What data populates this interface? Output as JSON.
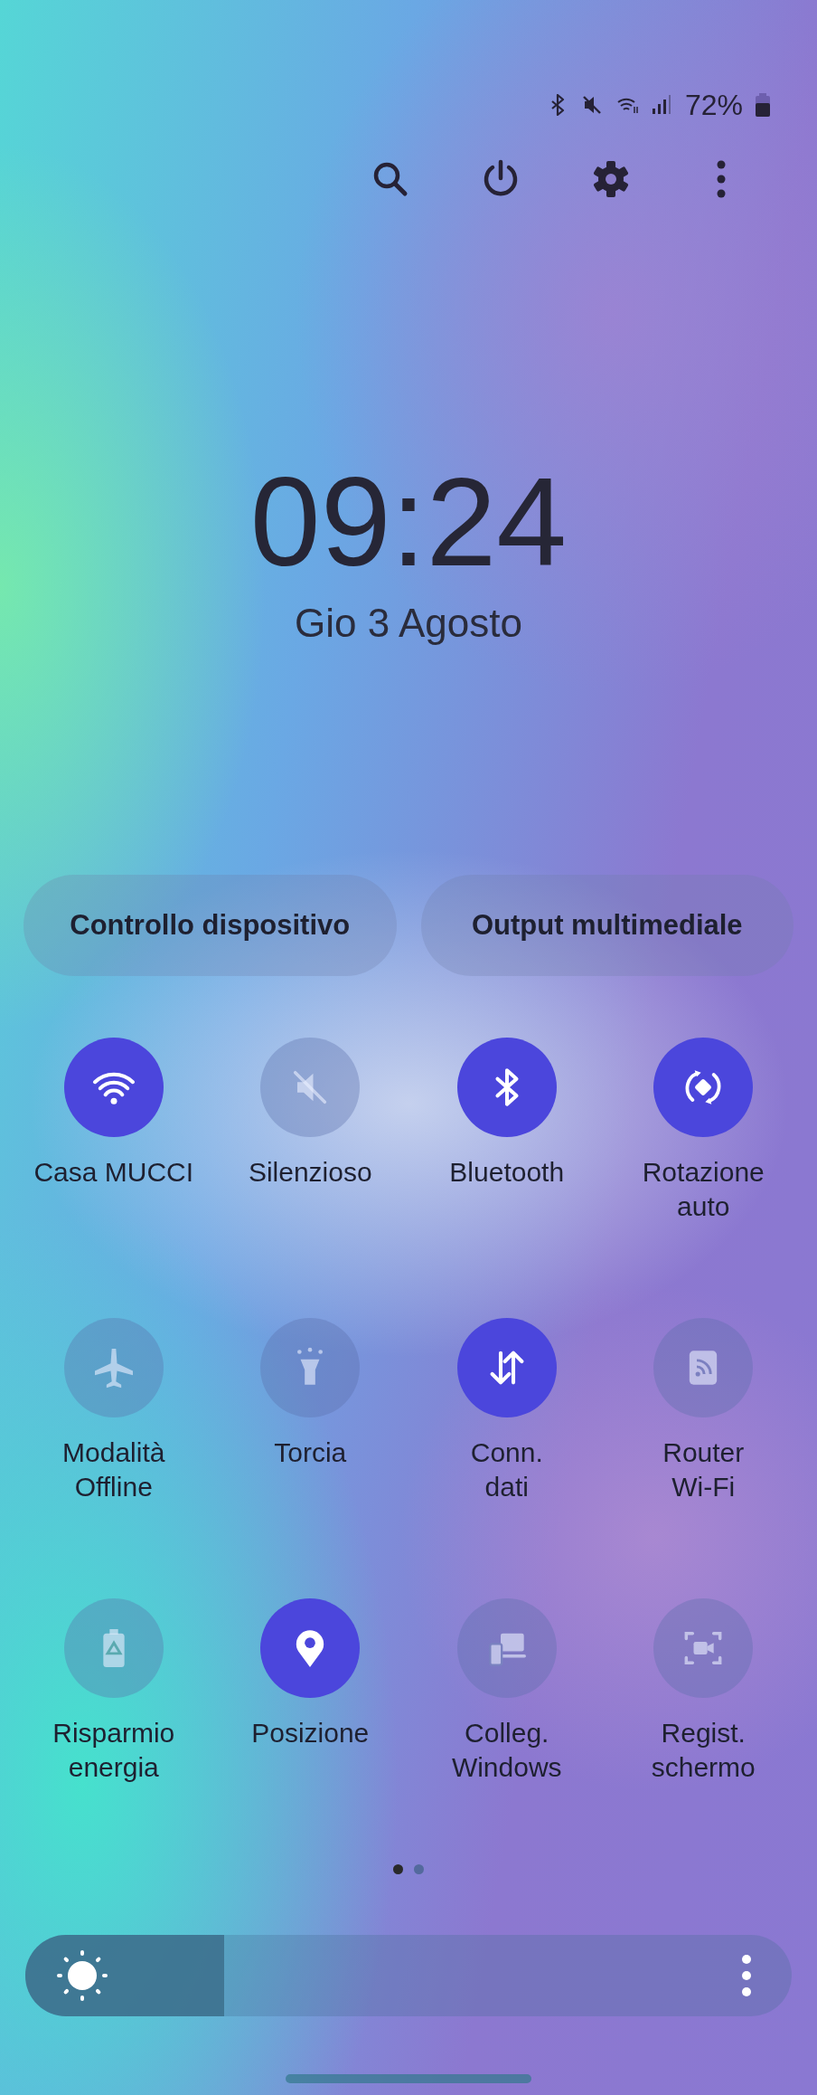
{
  "status_bar": {
    "icons": [
      {
        "kind": "bluetooth"
      },
      {
        "kind": "mute"
      },
      {
        "kind": "wifi"
      },
      {
        "kind": "signal"
      }
    ],
    "battery": "72%"
  },
  "toolbar": [
    {
      "kind": "search"
    },
    {
      "kind": "power"
    },
    {
      "kind": "settings"
    },
    {
      "kind": "more"
    }
  ],
  "clock": {
    "time": "09:24",
    "date": "Gio 3 Agosto"
  },
  "buttons": [
    "Controllo dispositivo",
    "Output multimediale"
  ],
  "tiles": [
    {
      "kind": "wifi",
      "label": "Casa MUCCI",
      "on": true
    },
    {
      "kind": "mute",
      "label": "Silenzioso",
      "on": false
    },
    {
      "kind": "bluetooth",
      "label": "Bluetooth",
      "on": true
    },
    {
      "kind": "rotate",
      "label": "Rotazione\nauto",
      "on": true
    },
    {
      "kind": "airplane",
      "label": "Modalità\nOffline",
      "on": false
    },
    {
      "kind": "flashlight",
      "label": "Torcia",
      "on": false
    },
    {
      "kind": "data",
      "label": "Conn.\ndati",
      "on": true
    },
    {
      "kind": "hotspot",
      "label": "Router\nWi-Fi",
      "on": false
    },
    {
      "kind": "battery",
      "label": "Risparmio\nenergia",
      "on": false
    },
    {
      "kind": "location",
      "label": "Posizione",
      "on": true
    },
    {
      "kind": "windows",
      "label": "Colleg.\nWindows",
      "on": false
    },
    {
      "kind": "record",
      "label": "Regist.\nschermo",
      "on": false
    }
  ],
  "pages": [
    {
      "selected": true
    },
    {
      "selected": false
    }
  ],
  "brightness": {
    "level": 0.26
  }
}
